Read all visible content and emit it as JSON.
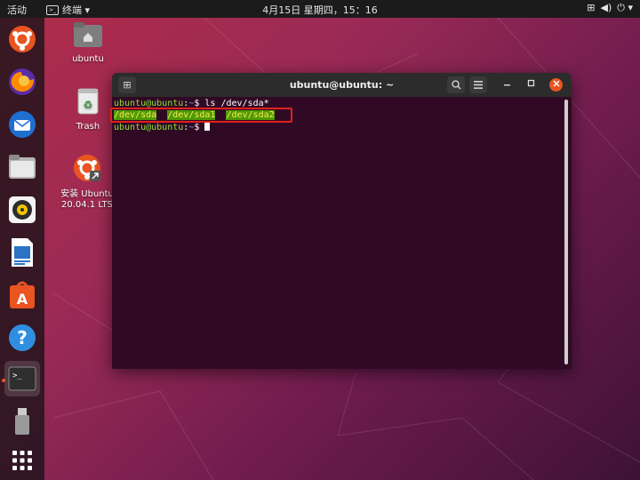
{
  "topbar": {
    "activities": "活动",
    "app_menu": "终端 ▾",
    "clock": "4月15日 星期四，15：16",
    "tray": {
      "network": "⊞",
      "volume": "◀)",
      "power": "⏻ ▾"
    }
  },
  "dock": {
    "items": [
      {
        "name": "ubuntu-installer"
      },
      {
        "name": "firefox"
      },
      {
        "name": "thunderbird"
      },
      {
        "name": "files"
      },
      {
        "name": "rhythmbox"
      },
      {
        "name": "libreoffice-writer"
      },
      {
        "name": "ubuntu-software"
      },
      {
        "name": "help"
      },
      {
        "name": "terminal",
        "active": true
      },
      {
        "name": "usb-drive"
      },
      {
        "name": "show-applications"
      }
    ]
  },
  "desktop": {
    "home_label": "ubuntu",
    "trash_label": "Trash",
    "install_label_line1": "安装 Ubuntu",
    "install_label_line2": "20.04.1 LTS"
  },
  "terminal": {
    "title": "ubuntu@ubuntu: ~",
    "lines": {
      "l1_user": "ubuntu@ubuntu",
      "l1_colon": ":",
      "l1_path": "~",
      "l1_cmd": "$ ls /dev/sda*",
      "l2_a": "/dev/sda",
      "l2_b": "/dev/sda1",
      "l2_c": "/dev/sda2",
      "l3_user": "ubuntu@ubuntu",
      "l3_colon": ":",
      "l3_path": "~",
      "l3_cmd": "$ "
    }
  },
  "colors": {
    "accent": "#e95420",
    "highlight_border": "#e0201c",
    "terminal_bg": "#300a24"
  }
}
